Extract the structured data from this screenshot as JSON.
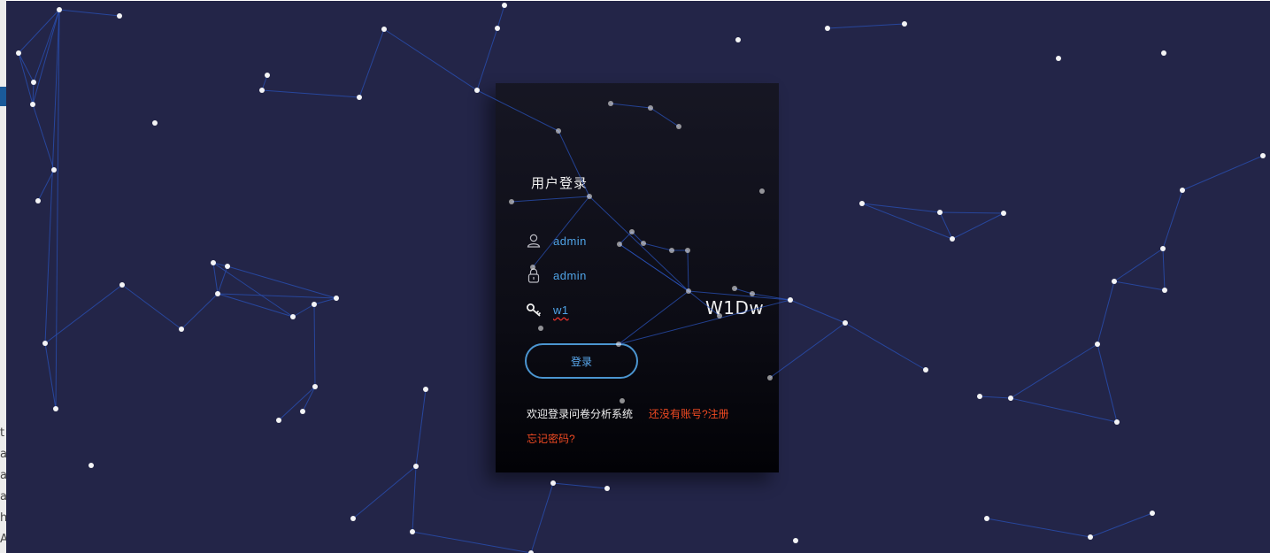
{
  "login": {
    "title": "用户登录",
    "username_value": "admin",
    "password_value": "admin",
    "captcha_value": "w1",
    "captcha_image_text": "W1Dw",
    "login_button": "登录",
    "welcome_text": "欢迎登录问卷分析系统",
    "register_link": "还没有账号?注册",
    "forgot_link": "忘记密码?"
  },
  "icons": {
    "username": "user-icon",
    "password": "lock-icon",
    "captcha": "key-icon"
  },
  "left_edge": {
    "chars": [
      "t",
      "a",
      "a",
      "a",
      "h",
      "A"
    ]
  },
  "colors": {
    "background": "#232548",
    "link_lines": "#2a52b8",
    "particles": "#ffffff",
    "input_text": "#4fa3e6",
    "accent_link": "#f04a22",
    "button_border": "#4b95d0"
  }
}
